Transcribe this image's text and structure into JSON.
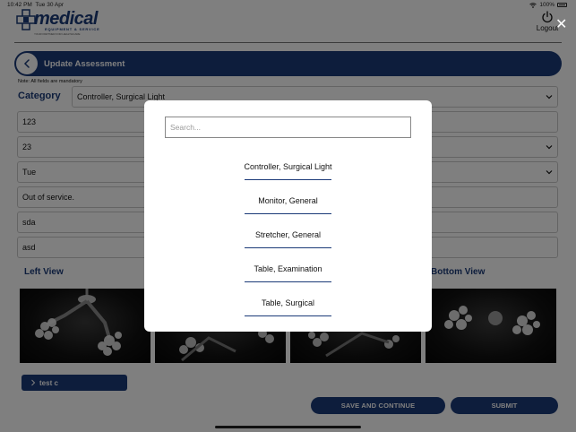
{
  "status_bar": {
    "time": "10:42 PM",
    "date": "Tue 30 Apr",
    "battery": "100%"
  },
  "brand": {
    "logo_text": "medical",
    "logo_sub": "EQUIPMENT & SERVICE",
    "logo_tagline": "YOUR PARTNER FOR HEALTHCARE"
  },
  "header": {
    "logout_label": "Logout"
  },
  "page": {
    "title": "Update Assessment",
    "note": "Note: All fields are mandatory",
    "category_label": "Category",
    "category_value": "Controller, Surgical Light",
    "fields": [
      "123",
      "23",
      "Tue",
      "Out of service.",
      "sda",
      "asd"
    ],
    "view_labels": {
      "left": "Left View",
      "bottom": "Bottom View"
    },
    "collapsible_label": "test c",
    "save_button": "SAVE AND CONTINUE",
    "submit_button": "SUBMIT"
  },
  "modal": {
    "search_placeholder": "Search...",
    "options": [
      "Controller, Surgical Light",
      "Monitor, General",
      "Stretcher, General",
      "Table, Examination",
      "Table, Surgical"
    ]
  },
  "colors": {
    "brand_navy": "#1b3a78",
    "overlay": "rgba(0,0,0,0.5)"
  }
}
